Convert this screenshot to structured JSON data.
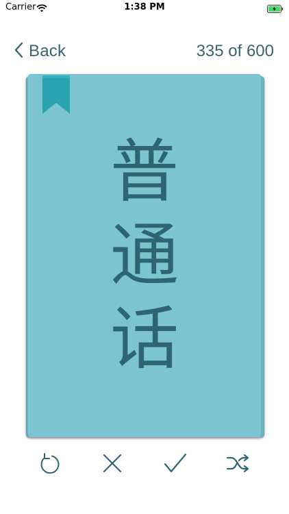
{
  "status_bar": {
    "carrier": "Carrier",
    "time": "1:38 PM"
  },
  "nav": {
    "back_label": "Back",
    "counter": "335 of 600"
  },
  "card": {
    "characters": [
      "普",
      "通",
      "话"
    ]
  },
  "colors": {
    "card": "#7dc4d2",
    "bookmark": "#2aa3b1",
    "text": "#2d6573",
    "nav_text": "#3b6470"
  },
  "toolbar": {
    "icons": [
      "undo-icon",
      "close-icon",
      "checkmark-icon",
      "shuffle-icon"
    ]
  }
}
